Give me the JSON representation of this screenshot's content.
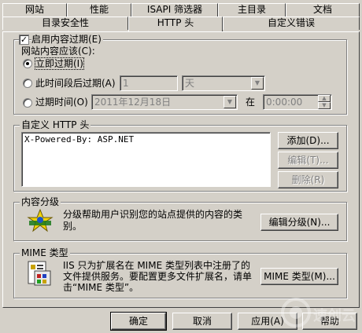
{
  "tabs_row1": [
    "网站",
    "性能",
    "ISAPI 筛选器",
    "主目录",
    "文档"
  ],
  "tabs_row2": [
    "目录安全性",
    "HTTP 头",
    "自定义错误"
  ],
  "expire": {
    "checkbox_label": "启用内容过期(E)",
    "content_should_label": "网站内容应该(C):",
    "radio_immediate": "立即过期(I)",
    "radio_after": "此时间段后过期(A)",
    "after_value": "1",
    "after_unit": "天",
    "radio_on": "过期时间(O)",
    "date_value": "2011年12月18日",
    "at_label": "在",
    "time_value": "0:00:00"
  },
  "custom_headers": {
    "legend": "自定义 HTTP 头",
    "items": [
      "X-Powered-By: ASP.NET"
    ],
    "add_label": "添加(D)...",
    "edit_label": "编辑(T)...",
    "delete_label": "删除(R)"
  },
  "rating": {
    "legend": "内容分级",
    "description": "分级帮助用户识别您的站点提供的内容的类别。",
    "edit_label": "编辑分级(N)..."
  },
  "mime": {
    "legend": "MIME 类型",
    "description": "IIS 只为扩展名在 MIME 类型列表中注册了的文件提供服务。要配置更多文件扩展名，请单击“MIME 类型”。",
    "button_label": "MIME 类型(M)..."
  },
  "footer": {
    "ok": "确定",
    "cancel": "取消",
    "apply": "应用(A)",
    "help": "帮助"
  },
  "watermark": "速创云"
}
